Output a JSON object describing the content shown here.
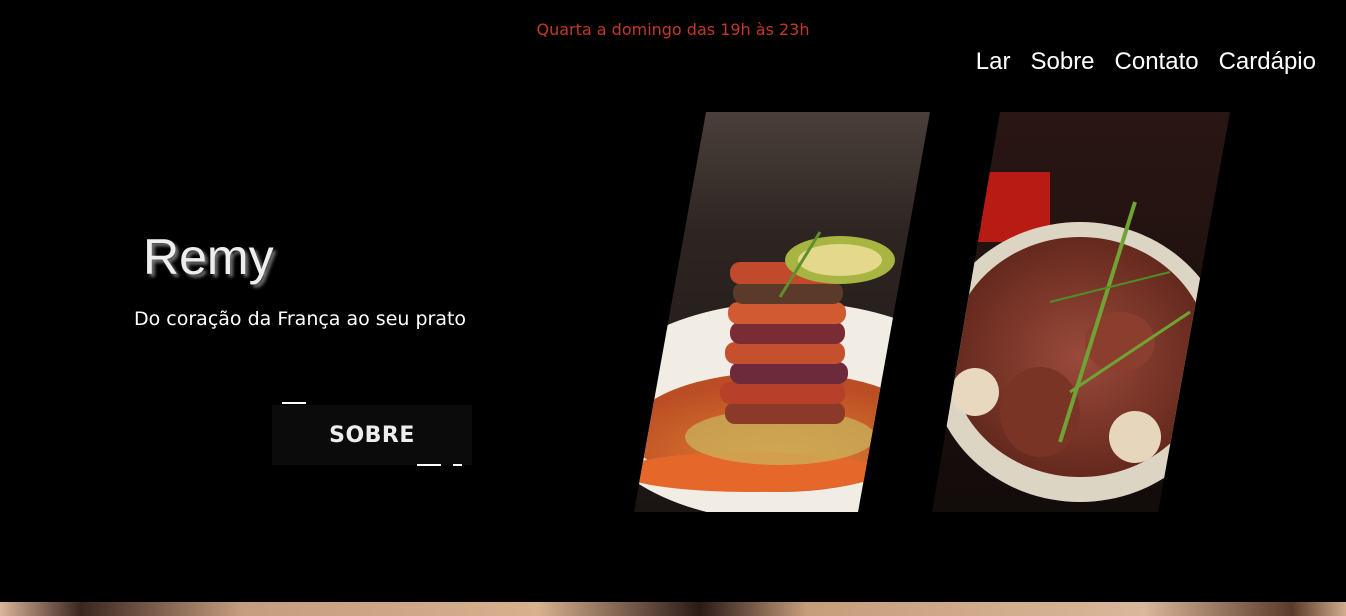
{
  "header": {
    "hours": "Quarta a domingo das 19h às 23h",
    "hours_color": "#c0392b"
  },
  "nav": {
    "items": [
      "Lar",
      "Sobre",
      "Contato",
      "Cardápio"
    ]
  },
  "hero": {
    "title": "Remy",
    "tagline": "Do coração da França ao seu prato",
    "button_label": "SOBRE"
  },
  "gallery": {
    "images": [
      "ratatouille-photo",
      "coq-au-vin-photo"
    ]
  }
}
